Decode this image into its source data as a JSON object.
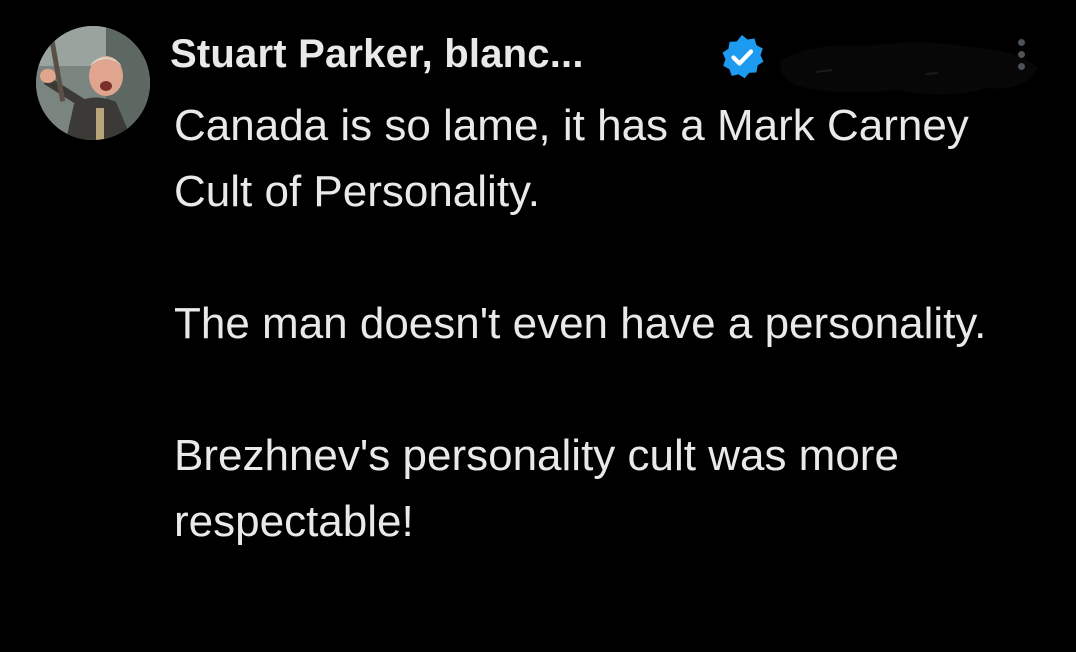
{
  "post": {
    "author_name": "Stuart Parker, blanc...",
    "verified": true,
    "paragraphs": [
      "Canada is so lame, it has a Mark Carney Cult of Personality.",
      "The man doesn't even have a personality.",
      "Brezhnev's personality cult was more respectable!"
    ]
  },
  "icons": {
    "avatar": "profile-photo",
    "verified": "verified-checkmark-icon",
    "more": "more-vertical-icon"
  },
  "colors": {
    "background": "#000000",
    "text": "#e7e9ea",
    "verified_blue": "#1d9bf0",
    "more_dots": "#4d5257"
  }
}
